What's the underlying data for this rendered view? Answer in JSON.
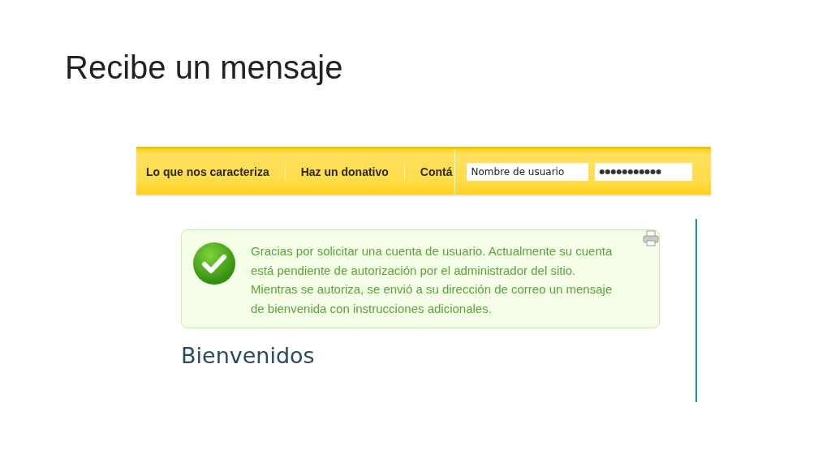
{
  "slide_title": "Recibe un mensaje",
  "nav": {
    "items": [
      {
        "label": "Lo que nos caracteriza"
      },
      {
        "label": "Haz un donativo"
      },
      {
        "label": "Contá"
      }
    ],
    "username_field": {
      "placeholder": "Nombre de usuario"
    },
    "password_field": {
      "value": "●●●●●●●●●●●"
    }
  },
  "message": {
    "kind": "success",
    "paragraphs": [
      "Gracias por solicitar una cuenta de usuario. Actualmente su cuenta está pendiente de autorización por el administrador del sitio.",
      "Mientras se autoriza, se envió a su dirección de correo un mensaje de bienvenida con instrucciones adicionales."
    ]
  },
  "heading": "Bienvenidos"
}
